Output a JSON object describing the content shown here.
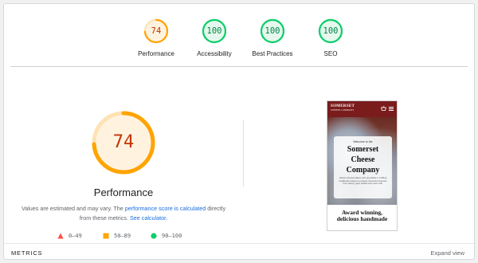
{
  "colors": {
    "orange": "#ffa400",
    "orange_text": "#c33300",
    "green": "#0cce6b",
    "green_text": "#018642",
    "red": "#ff4e42"
  },
  "categories": [
    {
      "id": "performance",
      "label": "Performance",
      "score": "74",
      "score_value": 74,
      "rating": "average"
    },
    {
      "id": "accessibility",
      "label": "Accessibility",
      "score": "100",
      "score_value": 100,
      "rating": "pass"
    },
    {
      "id": "best-practices",
      "label": "Best Practices",
      "score": "100",
      "score_value": 100,
      "rating": "pass"
    },
    {
      "id": "seo",
      "label": "SEO",
      "score": "100",
      "score_value": 100,
      "rating": "pass"
    }
  ],
  "main": {
    "score": "74",
    "score_value": 74,
    "title": "Performance",
    "note_prefix": "Values are estimated and may vary. The ",
    "note_link": "performance score is calculated",
    "note_middle": " directly from these metrics. ",
    "note_calc": "See calculator.",
    "legend": [
      {
        "icon": "triangle-red-icon",
        "range": "0–49"
      },
      {
        "icon": "square-orange-icon",
        "range": "50–89"
      },
      {
        "icon": "circle-green-icon",
        "range": "90–100"
      }
    ]
  },
  "screenshot": {
    "brand": "SOMERSET",
    "brand_sub": "CHEESE COMPANY",
    "welcome": "Welcome to the",
    "heading_1": "Somerset",
    "heading_2": "Cheese",
    "heading_3": "Company",
    "body": "Artisan cheesemakers who specialise in crafting traditional recipes to produce cheeseful cheeses from sheep, goat, buffalo and cows milk.",
    "tagline_1": "Award winning,",
    "tagline_2": "delicious handmade"
  },
  "footer": {
    "metrics_label": "METRICS",
    "expand_label": "Expand view"
  }
}
